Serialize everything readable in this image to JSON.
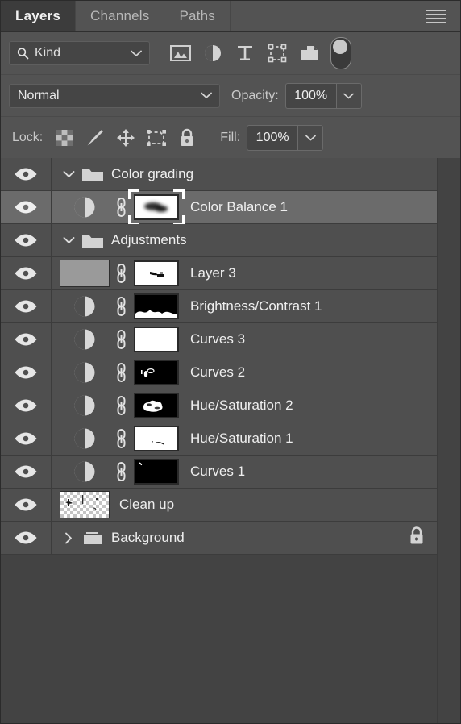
{
  "panel": {
    "tabs": [
      {
        "label": "Layers",
        "active": true
      },
      {
        "label": "Channels",
        "active": false
      },
      {
        "label": "Paths",
        "active": false
      }
    ],
    "menu_icon": "hamburger-menu-icon"
  },
  "filter": {
    "kind_label": "Kind",
    "search_icon": "search-icon",
    "chevron_icon": "chevron-down-icon",
    "type_filters": [
      {
        "name": "filter-pixel-layers-icon"
      },
      {
        "name": "filter-adjustment-layers-icon"
      },
      {
        "name": "filter-type-layers-icon"
      },
      {
        "name": "filter-shape-layers-icon"
      },
      {
        "name": "filter-smart-object-layers-icon"
      }
    ],
    "toggle_name": "filter-enable-toggle"
  },
  "blend": {
    "mode": "Normal",
    "opacity_label": "Opacity:",
    "opacity_value": "100%"
  },
  "lock": {
    "label": "Lock:",
    "icons": [
      {
        "name": "lock-transparent-pixels-icon"
      },
      {
        "name": "lock-image-pixels-icon"
      },
      {
        "name": "lock-position-icon"
      },
      {
        "name": "lock-artboard-nesting-icon"
      },
      {
        "name": "lock-all-icon"
      }
    ],
    "fill_label": "Fill:",
    "fill_value": "100%"
  },
  "layers": [
    {
      "name": "Color grading",
      "type": "group",
      "expanded": true,
      "visible": true,
      "selected": false,
      "indent": 0,
      "locked": false
    },
    {
      "name": "Color Balance 1",
      "type": "adjustment",
      "visible": true,
      "selected": true,
      "indent": 1,
      "mask": "blurred-dark-blob-on-white",
      "linked": true,
      "locked": false
    },
    {
      "name": "Adjustments",
      "type": "group",
      "expanded": true,
      "visible": true,
      "selected": false,
      "indent": 0,
      "locked": false
    },
    {
      "name": "Layer 3",
      "type": "pixel",
      "visible": true,
      "selected": false,
      "indent": 1,
      "thumbnail": "flat-gray-noise",
      "mask": "small-dark-stroke-on-white",
      "linked": true,
      "locked": false
    },
    {
      "name": "Brightness/Contrast 1",
      "type": "adjustment",
      "visible": true,
      "selected": false,
      "indent": 1,
      "mask": "black-with-white-bottom-edge",
      "linked": true,
      "locked": false
    },
    {
      "name": "Curves 3",
      "type": "adjustment",
      "visible": true,
      "selected": false,
      "indent": 1,
      "mask": "all-white",
      "linked": true,
      "locked": false
    },
    {
      "name": "Curves 2",
      "type": "adjustment",
      "visible": true,
      "selected": false,
      "indent": 1,
      "mask": "black-with-small-white-marks",
      "linked": true,
      "locked": false
    },
    {
      "name": "Hue/Saturation 2",
      "type": "adjustment",
      "visible": true,
      "selected": false,
      "indent": 1,
      "mask": "black-with-white-cloud-shape",
      "linked": true,
      "locked": false
    },
    {
      "name": "Hue/Saturation 1",
      "type": "adjustment",
      "visible": true,
      "selected": false,
      "indent": 1,
      "mask": "white-with-small-dark-marks",
      "linked": true,
      "locked": false
    },
    {
      "name": "Curves 1",
      "type": "adjustment",
      "visible": true,
      "selected": false,
      "indent": 1,
      "mask": "all-black-with-tiny-white-mark",
      "linked": true,
      "locked": false
    },
    {
      "name": "Clean up",
      "type": "pixel",
      "visible": true,
      "selected": false,
      "indent": 1,
      "thumbnail": "transparent-checkerboard-with-marks",
      "linked": false,
      "locked": false
    },
    {
      "name": "Background",
      "type": "group",
      "expanded": false,
      "visible": true,
      "selected": false,
      "indent": 0,
      "locked": true,
      "lock_icon": "lock-icon"
    }
  ],
  "colors": {
    "panel_bg": "#535353",
    "row_bg": "#4f4f4f",
    "row_selected_bg": "#6b6b6b",
    "tab_active_bg": "#3c3c3c",
    "text": "#efefef",
    "muted_text": "#c9c9c9",
    "field_bg": "#454545",
    "list_bg": "#434343"
  }
}
